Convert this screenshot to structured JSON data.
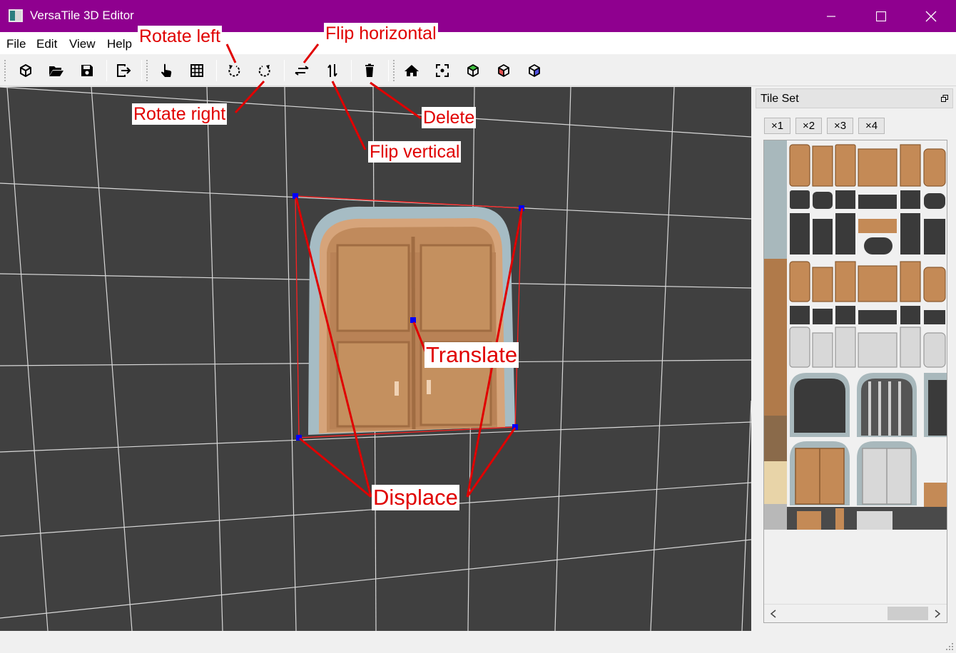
{
  "window": {
    "title": "VersaTile 3D Editor"
  },
  "menu": {
    "items": [
      "File",
      "Edit",
      "View",
      "Help"
    ]
  },
  "toolbar": {
    "icons": [
      "new-icon",
      "open-folder-icon",
      "save-icon",
      "export-icon",
      "hand-select-icon",
      "grid-icon",
      "rotate-left-icon",
      "rotate-right-icon",
      "flip-horizontal-icon",
      "flip-vertical-icon",
      "delete-icon",
      "home-icon",
      "center-view-icon",
      "cube-green-icon",
      "cube-red-icon",
      "cube-blue-icon"
    ]
  },
  "panel": {
    "title": "Tile Set",
    "zoom_options": [
      "×1",
      "×2",
      "×3",
      "×4"
    ]
  },
  "callouts": {
    "rotate_left": "Rotate left",
    "flip_horizontal": "Flip horizontal",
    "rotate_right": "Rotate right",
    "delete": "Delete",
    "flip_vertical": "Flip vertical",
    "translate": "Translate",
    "displace": "Displace"
  },
  "colors": {
    "title_bar": "#8f008f",
    "viewport_bg": "#404040",
    "grid_line": "#d8d8d8",
    "handle": "#0000ff",
    "selection": "#ff0000",
    "callout_text": "#e00000",
    "door_wood": "#c08a5c",
    "door_frame": "#a6bcc4"
  }
}
